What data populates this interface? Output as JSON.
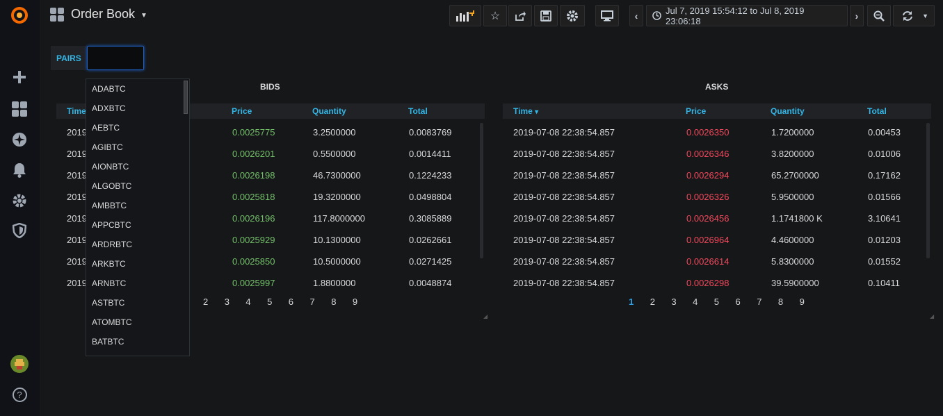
{
  "app": {
    "dashboard_title": "Order Book",
    "time_range": "Jul 7, 2019 15:54:12 to Jul 8, 2019 23:06:18"
  },
  "colors": {
    "accent": "#33b5e5",
    "bid_price": "#73bf69",
    "ask_price": "#f2495c",
    "active_page": "#33a2e5"
  },
  "sidemenu": {
    "icons": [
      "grafana-logo-icon",
      "plus-icon",
      "dashboards-icon",
      "explore-icon",
      "bell-icon",
      "gear-icon",
      "shield-icon",
      "avatar",
      "help-icon"
    ],
    "help_glyph": "?"
  },
  "variables": {
    "pairs_label": "PAIRS",
    "pairs_value": ""
  },
  "dropdown": {
    "options": [
      "ADABTC",
      "ADXBTC",
      "AEBTC",
      "AGIBTC",
      "AIONBTC",
      "ALGOBTC",
      "AMBBTC",
      "APPCBTC",
      "ARDRBTC",
      "ARKBTC",
      "ARNBTC",
      "ASTBTC",
      "ATOMBTC",
      "BATBTC"
    ]
  },
  "bids": {
    "title": "BIDS",
    "columns": {
      "time": "Time",
      "price": "Price",
      "quantity": "Quantity",
      "total": "Total"
    },
    "rows": [
      {
        "time_prefix": "2019",
        "price": "0.0025775",
        "quantity": "3.2500000",
        "total": "0.0083769"
      },
      {
        "time_prefix": "2019",
        "price": "0.0026201",
        "quantity": "0.5500000",
        "total": "0.0014411"
      },
      {
        "time_prefix": "2019",
        "price": "0.0026198",
        "quantity": "46.7300000",
        "total": "0.1224233"
      },
      {
        "time_prefix": "2019",
        "price": "0.0025818",
        "quantity": "19.3200000",
        "total": "0.0498804"
      },
      {
        "time_prefix": "2019",
        "price": "0.0026196",
        "quantity": "117.8000000",
        "total": "0.3085889"
      },
      {
        "time_prefix": "2019",
        "price": "0.0025929",
        "quantity": "10.1300000",
        "total": "0.0262661"
      },
      {
        "time_prefix": "2019",
        "price": "0.0025850",
        "quantity": "10.5000000",
        "total": "0.0271425"
      },
      {
        "time_prefix": "2019",
        "price": "0.0025997",
        "quantity": "1.8800000",
        "total": "0.0048874"
      }
    ],
    "pages": [
      "2",
      "3",
      "4",
      "5",
      "6",
      "7",
      "8",
      "9"
    ]
  },
  "asks": {
    "title": "ASKS",
    "columns": {
      "time": "Time",
      "price": "Price",
      "quantity": "Quantity",
      "total": "Total"
    },
    "sort_indicator": "▾",
    "rows": [
      {
        "time": "2019-07-08 22:38:54.857",
        "price": "0.0026350",
        "quantity": "1.7200000",
        "total": "0.00453"
      },
      {
        "time": "2019-07-08 22:38:54.857",
        "price": "0.0026346",
        "quantity": "3.8200000",
        "total": "0.01006"
      },
      {
        "time": "2019-07-08 22:38:54.857",
        "price": "0.0026294",
        "quantity": "65.2700000",
        "total": "0.17162"
      },
      {
        "time": "2019-07-08 22:38:54.857",
        "price": "0.0026326",
        "quantity": "5.9500000",
        "total": "0.01566"
      },
      {
        "time": "2019-07-08 22:38:54.857",
        "price": "0.0026456",
        "quantity": "1.1741800 K",
        "total": "3.10641"
      },
      {
        "time": "2019-07-08 22:38:54.857",
        "price": "0.0026964",
        "quantity": "4.4600000",
        "total": "0.01203"
      },
      {
        "time": "2019-07-08 22:38:54.857",
        "price": "0.0026614",
        "quantity": "5.8300000",
        "total": "0.01552"
      },
      {
        "time": "2019-07-08 22:38:54.857",
        "price": "0.0026298",
        "quantity": "39.5900000",
        "total": "0.10411"
      }
    ],
    "pages": [
      "1",
      "2",
      "3",
      "4",
      "5",
      "6",
      "7",
      "8",
      "9"
    ],
    "active_page": "1"
  }
}
